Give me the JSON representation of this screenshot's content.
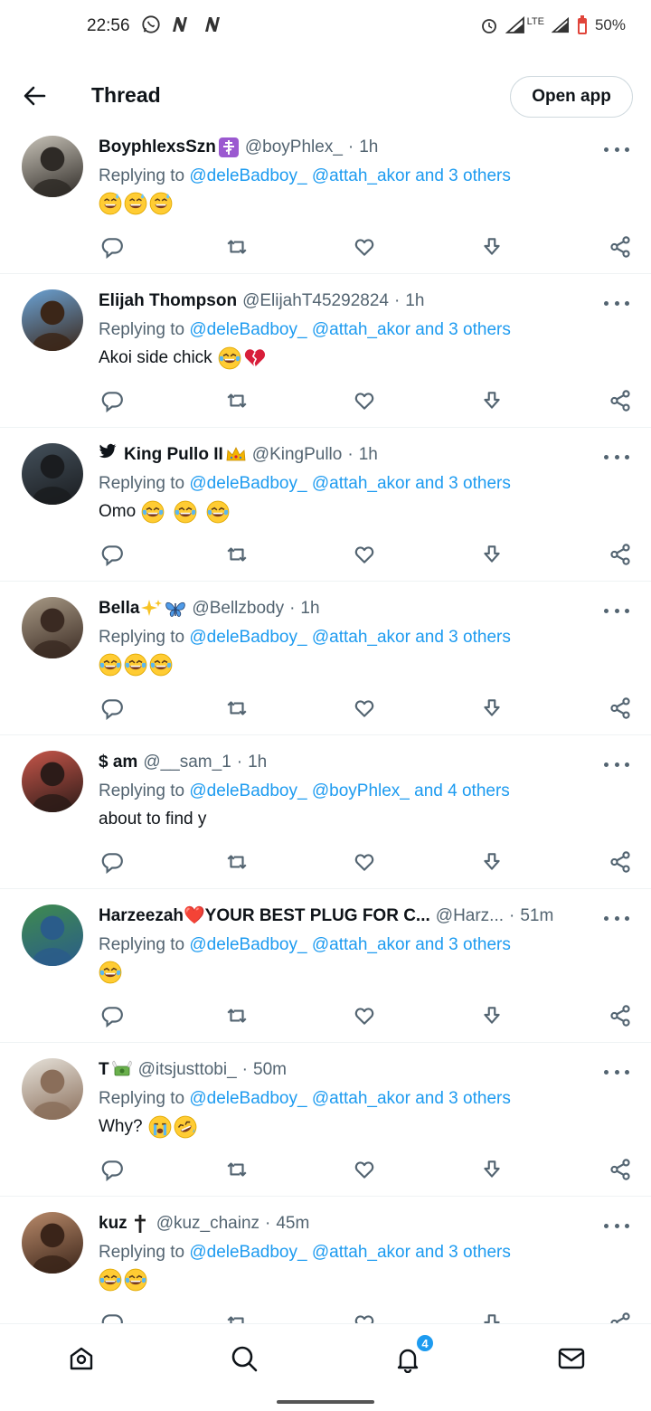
{
  "status_bar": {
    "time": "22:56",
    "battery": "50%",
    "network": "LTE"
  },
  "header": {
    "title": "Thread",
    "open_app_label": "Open app"
  },
  "reply_prefix": "Replying to",
  "tweets": [
    {
      "name": "BoyphlexsSzn",
      "name_emoji": "orthodox-cross",
      "handle": "@boyPhlex_",
      "time": "1h",
      "reply_to": [
        "@deleBadboy_",
        "@attah_akor",
        "and 3 others"
      ],
      "text": "",
      "emojis": [
        "sweat-smile",
        "sweat-smile",
        "sweat-smile"
      ],
      "avatar_colors": [
        "#c8c3b8",
        "#2e2a26"
      ]
    },
    {
      "name": "Elijah Thompson",
      "name_emoji": "",
      "handle": "@ElijahT45292824",
      "time": "1h",
      "reply_to": [
        "@deleBadboy_",
        "@attah_akor",
        "and 3 others"
      ],
      "text": "Akoi side chick",
      "emojis": [
        "joy",
        "broken-heart"
      ],
      "avatar_colors": [
        "#6ba3d6",
        "#3b2618"
      ]
    },
    {
      "name": "King Pullo II",
      "name_emoji": "crown",
      "handle": "@KingPullo",
      "time": "1h",
      "reply_to": [
        "@deleBadboy_",
        "@attah_akor",
        "and 3 others"
      ],
      "text": "Omo",
      "emojis": [
        "joy",
        "joy",
        "joy"
      ],
      "avatar_colors": [
        "#44515c",
        "#1a1c1f"
      ]
    },
    {
      "name": "Bella",
      "name_emoji": "sparkles-butterfly",
      "handle": "@Bellzbody",
      "time": "1h",
      "reply_to": [
        "@deleBadboy_",
        "@attah_akor",
        "and 3 others"
      ],
      "text": "",
      "emojis": [
        "joy",
        "joy",
        "joy"
      ],
      "avatar_colors": [
        "#a89a86",
        "#3a2a22"
      ]
    },
    {
      "name": "$ am",
      "name_emoji": "",
      "handle": "@__sam_1",
      "time": "1h",
      "reply_to": [
        "@deleBadboy_",
        "@boyPhlex_",
        "and 4 others"
      ],
      "text": "about to find y",
      "emojis": [],
      "avatar_colors": [
        "#c7564a",
        "#2c1b18"
      ]
    },
    {
      "name": "Harzeezah❤️YOUR BEST PLUG FOR C...",
      "name_emoji": "",
      "handle": "@Harz...",
      "time": "51m",
      "reply_to": [
        "@deleBadboy_",
        "@attah_akor",
        "and 3 others"
      ],
      "text": "",
      "emojis": [
        "joy"
      ],
      "avatar_colors": [
        "#3f8b4e",
        "#2a5c8a"
      ]
    },
    {
      "name": "T",
      "name_emoji": "money-wings",
      "handle": "@itsjusttobi_",
      "time": "50m",
      "reply_to": [
        "@deleBadboy_",
        "@attah_akor",
        "and 3 others"
      ],
      "text": "Why?",
      "emojis": [
        "sob",
        "rofl"
      ],
      "avatar_colors": [
        "#e6e2da",
        "#8a6e5a"
      ]
    },
    {
      "name": "kuz",
      "name_emoji": "cross",
      "handle": "@kuz_chainz",
      "time": "45m",
      "reply_to": [
        "@deleBadboy_",
        "@attah_akor",
        "and 3 others"
      ],
      "text": "",
      "emojis": [
        "joy",
        "joy"
      ],
      "avatar_colors": [
        "#b98a6a",
        "#3a2419"
      ]
    }
  ],
  "bottom_nav": {
    "notification_count": "4"
  }
}
